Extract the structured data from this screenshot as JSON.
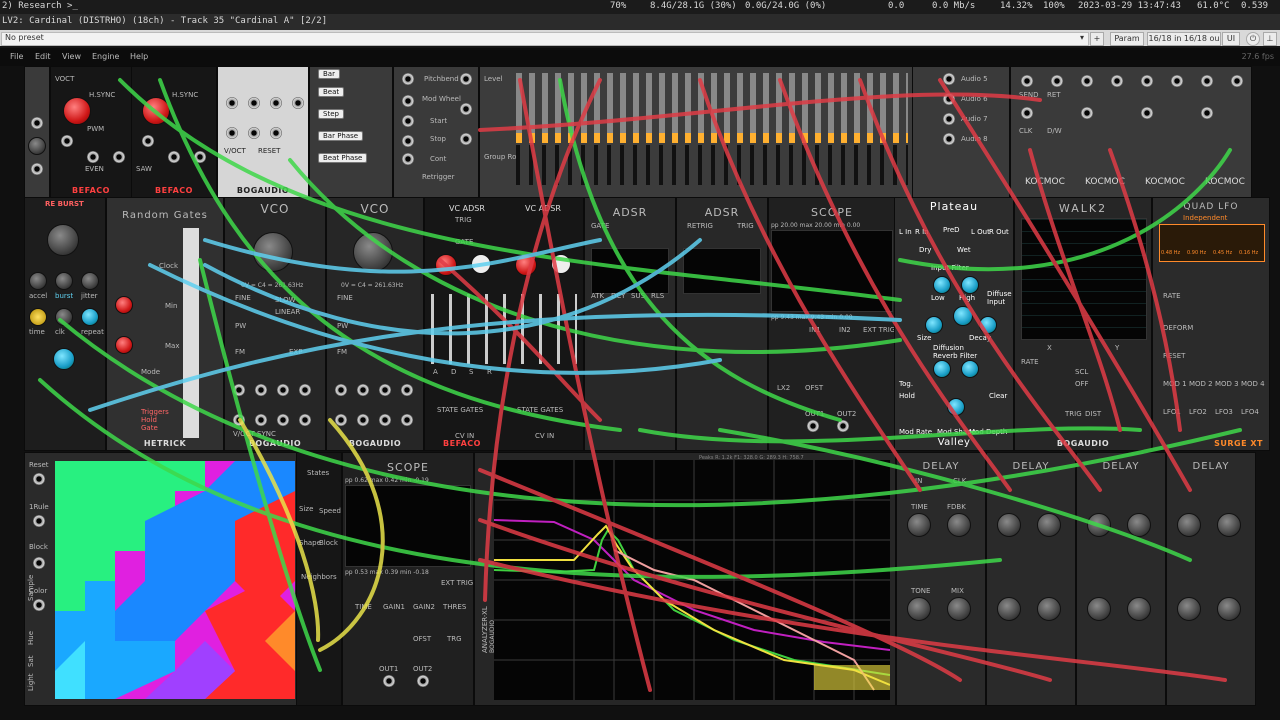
{
  "topbar": {
    "workspace": "2) Research >_",
    "cpu": "70%",
    "mem": "8.4G/28.1G (30%)",
    "swap": "0.0G/24.0G (0%)",
    "load": "0.0",
    "net": "0.0 Mb/s",
    "cpu2": "14.32%",
    "volume": "100%",
    "datetime": "2023-03-29 13:47:43",
    "temp": "61.0°C",
    "extra": "0.539"
  },
  "window": {
    "title": "LV2: Cardinal (DISTRHO) (18ch) - Track 35 \"Cardinal A\" [2/2]"
  },
  "presetbar": {
    "preset": "No preset",
    "plus": "+",
    "param": "Param",
    "io": "16/18 in 16/18 ou",
    "ui": "UI"
  },
  "menu": {
    "items": [
      "File",
      "Edit",
      "View",
      "Engine",
      "Help"
    ],
    "fps": "27.6 fps"
  },
  "modules": {
    "row1": {
      "vco_brand": "BEFACO",
      "vco_labels": [
        "VOCT",
        "FM",
        "H.SYNC",
        "PWM",
        "EVEN",
        "SAW",
        "TRI",
        "SIN"
      ],
      "bog_footer": "BOGAUDIO",
      "bog_labels": [
        "V/OCT",
        "RESET"
      ],
      "clock_buttons": [
        "Bar",
        "Beat",
        "Step",
        "Bar Phase",
        "Beat Phase"
      ],
      "transport": [
        "Pitchbend",
        "Mod Wheel",
        "Start",
        "Stop",
        "Cont",
        "Retrigger"
      ],
      "mixer_labels": [
        "Level",
        "Group Route"
      ],
      "audio_labels": [
        "Audio 5",
        "Audio 6",
        "Audio 7",
        "Audio 8"
      ],
      "kocmoc": [
        "KOCMOC",
        "KOCMOC",
        "KOCMOC",
        "KOCMOC"
      ],
      "kocmoc_labels": [
        "SEND",
        "RET",
        "CLK",
        "D/W"
      ]
    },
    "row2": {
      "reburst": "RE BURST",
      "reburst_labels": [
        "accel",
        "burst",
        "jitter",
        "time",
        "clk",
        "repeat"
      ],
      "random_gates": "Random Gates",
      "random_gates_labels": [
        "Clock",
        "Min",
        "Max",
        "Mode",
        "Triggers",
        "Hold",
        "Gate"
      ],
      "hetrick": "HETRICK",
      "vco1": "VCO",
      "vco2": "VCO",
      "vco_labels": [
        "FINE",
        "PW",
        "FM",
        "SLOW",
        "LINEAR",
        "EXP",
        "V/OCT",
        "SYNC",
        "SQR",
        "TRI",
        "SIN",
        "SAW"
      ],
      "vco_freq": "0V = C4 = 261.63Hz",
      "vcadsr": [
        "VC ADSR",
        "VC ADSR"
      ],
      "vcadsr_labels": [
        "TRIG",
        "GATE",
        "OUT",
        "A",
        "D",
        "S",
        "R",
        "STATE GATES",
        "CV IN"
      ],
      "befaco": "BEFACO",
      "adsr1": "ADSR",
      "adsr2": "ADSR",
      "adsr_labels": [
        "GATE",
        "RETRIG",
        "TRIG",
        "ATK",
        "DCY",
        "SUS",
        "RLS"
      ],
      "scope": "SCOPE",
      "scope_readout": "pp 20.00 max 20.00 min 0.00",
      "scope_readout2": "pp 9.43 max 9.43 min 0.00",
      "scope_labels": [
        "IN1",
        "IN2",
        "EXT TRIG",
        "OUT1",
        "OUT2",
        "OFST",
        "LX2"
      ],
      "plateau": "Plateau",
      "plateau_labels": [
        "L In",
        "R In",
        "L Out",
        "R Out",
        "Dry",
        "Wet",
        "PreD",
        "Input Filter",
        "Low",
        "High",
        "Diffuse Input",
        "Size",
        "Decay",
        "Diffusion",
        "Reverb Filter",
        "Mod Shape",
        "Mod Depth",
        "Mod Rate",
        "Tog.",
        "Hold",
        "Clear"
      ],
      "valley": "Valley",
      "walk2": "WALK2",
      "walk2_labels": [
        "RATE",
        "X",
        "Y",
        "SCL",
        "OFF",
        "TRIG",
        "DIST"
      ],
      "quadlfo": "QUAD LFO",
      "quadlfo_sub": "Independent",
      "quadlfo_freqs": [
        "0.48 Hz",
        "0.90 Hz",
        "0.45 Hz",
        "0.16 Hz"
      ],
      "quadlfo_labels": [
        "RATE",
        "DEFORM",
        "RESET",
        "MOD 1",
        "MOD 2",
        "MOD 3",
        "MOD 4",
        "LFO1",
        "LFO2",
        "LFO3",
        "LFO4"
      ],
      "surge": "SURGE XT",
      "bog": "BOGAUDIO"
    },
    "row3": {
      "ca_labels": [
        "Reset",
        "1Rule",
        "Block",
        "Color",
        "Sample",
        "Hue",
        "Sat",
        "Light"
      ],
      "ca_controls": [
        "States",
        "Size",
        "Shape",
        "Block",
        "Neighbors",
        "Speed"
      ],
      "scope": "SCOPE",
      "scope_readout": "pp 0.62 max 0.42 min -0.19",
      "scope_readout2": "pp 0.53 max 0.39 min -0.18",
      "scope_labels": [
        "TIME",
        "GAIN1",
        "GAIN2",
        "THRES",
        "EXT TRIG",
        "OFST",
        "TRG",
        "OUT1",
        "OUT2"
      ],
      "analyzer": "ANALYZER-XL",
      "analyzer_brand": "BOGAUDIO",
      "analyzer_readout": "Peaks  R: 1.2k  F1: 328.0  G: 289.3  H: 758.7",
      "delay": [
        "DELAY",
        "DELAY",
        "DELAY",
        "DELAY"
      ],
      "delay_labels": [
        "IN",
        "CLK",
        "TIME",
        "FDBK",
        "TONE",
        "MIX",
        "WET",
        "MIX"
      ]
    }
  },
  "colors": {
    "cable_green": "#3fd84a",
    "cable_red": "#e03c46",
    "cable_teal": "#5fd0f0",
    "cable_yellow": "#e8e24a",
    "brand_red": "#ff4040",
    "brand_orange": "#ff8a2a"
  }
}
